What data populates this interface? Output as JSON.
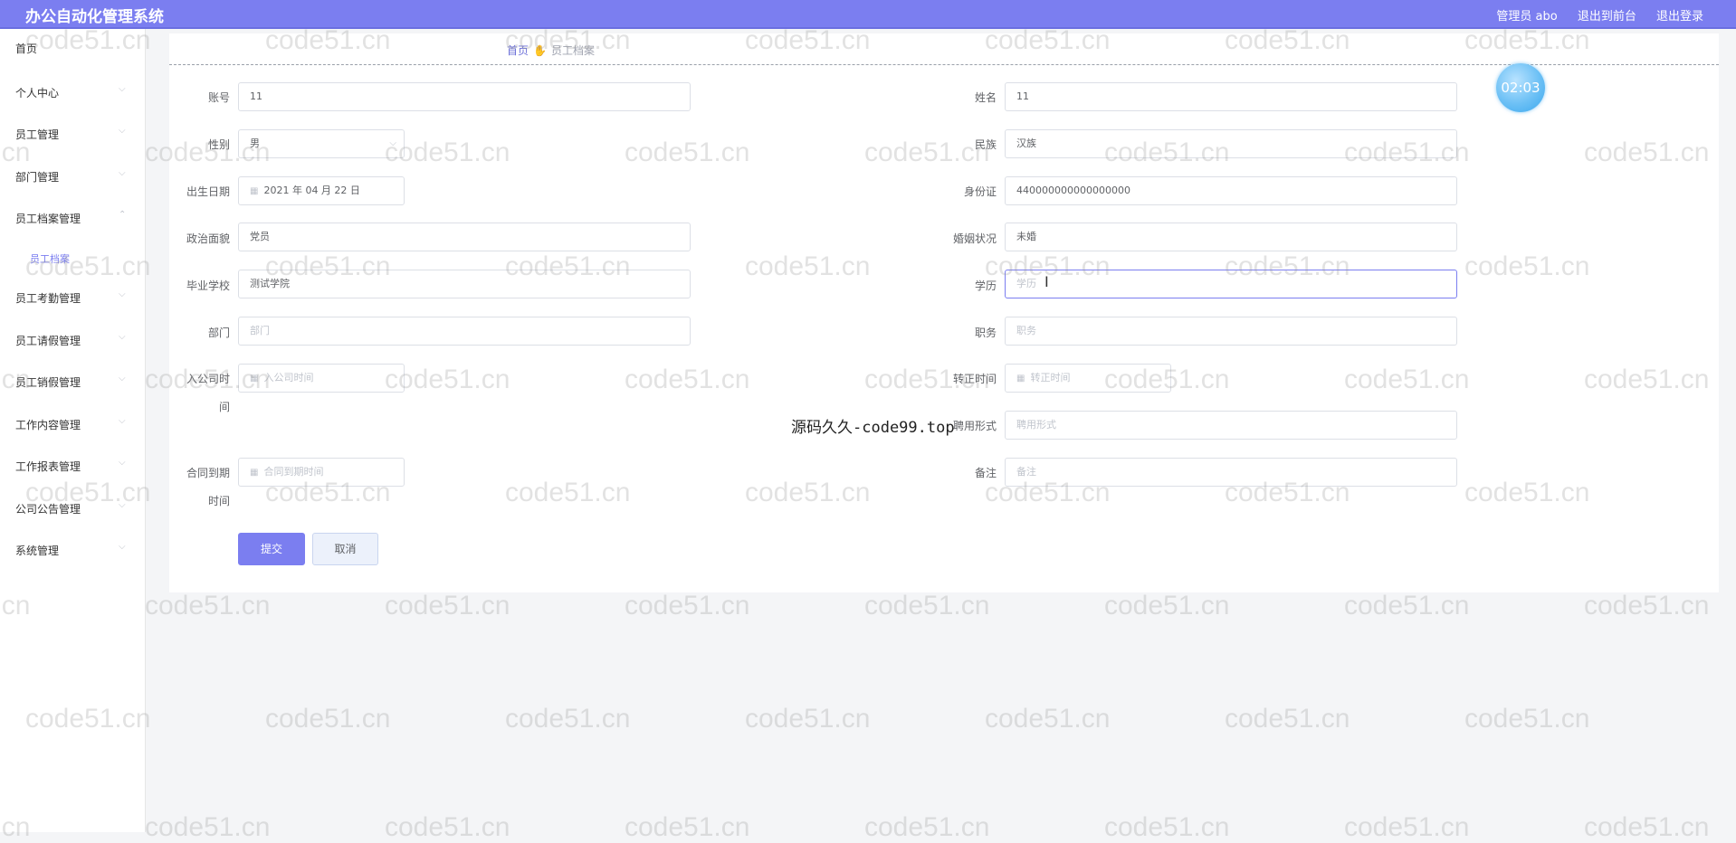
{
  "header": {
    "title": "办公自动化管理系统",
    "user": "管理员 abo",
    "front_link": "退出到前台",
    "logout_link": "退出登录"
  },
  "sidebar": {
    "items": [
      {
        "label": "首页"
      },
      {
        "label": "个人中心"
      },
      {
        "label": "员工管理"
      },
      {
        "label": "部门管理"
      },
      {
        "label": "员工档案管理"
      },
      {
        "label": "员工考勤管理"
      },
      {
        "label": "员工请假管理"
      },
      {
        "label": "员工销假管理"
      },
      {
        "label": "工作内容管理"
      },
      {
        "label": "工作报表管理"
      },
      {
        "label": "公司公告管理"
      },
      {
        "label": "系统管理"
      }
    ],
    "sub_item": "员工档案"
  },
  "breadcrumb": {
    "home": "首页",
    "current": "员工档案"
  },
  "clock": "02:03",
  "form": {
    "account": {
      "label": "账号",
      "value": "11"
    },
    "name": {
      "label": "姓名",
      "value": "11"
    },
    "gender": {
      "label": "性别",
      "value": "男"
    },
    "ethnicity": {
      "label": "民族",
      "value": "汉族"
    },
    "birthdate": {
      "label": "出生日期",
      "value": "2021 年 04 月 22 日"
    },
    "id_card": {
      "label": "身份证",
      "value": "440000000000000000"
    },
    "political": {
      "label": "政治面貌",
      "value": "党员"
    },
    "marital": {
      "label": "婚姻状况",
      "value": "未婚"
    },
    "school": {
      "label": "毕业学校",
      "value": "测试学院"
    },
    "education": {
      "label": "学历",
      "placeholder": "学历"
    },
    "department": {
      "label": "部门",
      "placeholder": "部门"
    },
    "position": {
      "label": "职务",
      "placeholder": "职务"
    },
    "join_date": {
      "label_line1": "入公司时",
      "label_line2": "间",
      "placeholder": "入公司时间"
    },
    "regular_date": {
      "label": "转正时间",
      "placeholder": "转正时间"
    },
    "employment": {
      "label": "聘用形式",
      "placeholder": "聘用形式"
    },
    "contract_date": {
      "label_line1": "合同到期",
      "label_line2": "时间",
      "placeholder": "合同到期时间"
    },
    "remark": {
      "label": "备注",
      "placeholder": "备注"
    },
    "submit": "提交",
    "cancel": "取消"
  },
  "watermark": "code51.cn",
  "overlay": "源码久久-code99.top"
}
